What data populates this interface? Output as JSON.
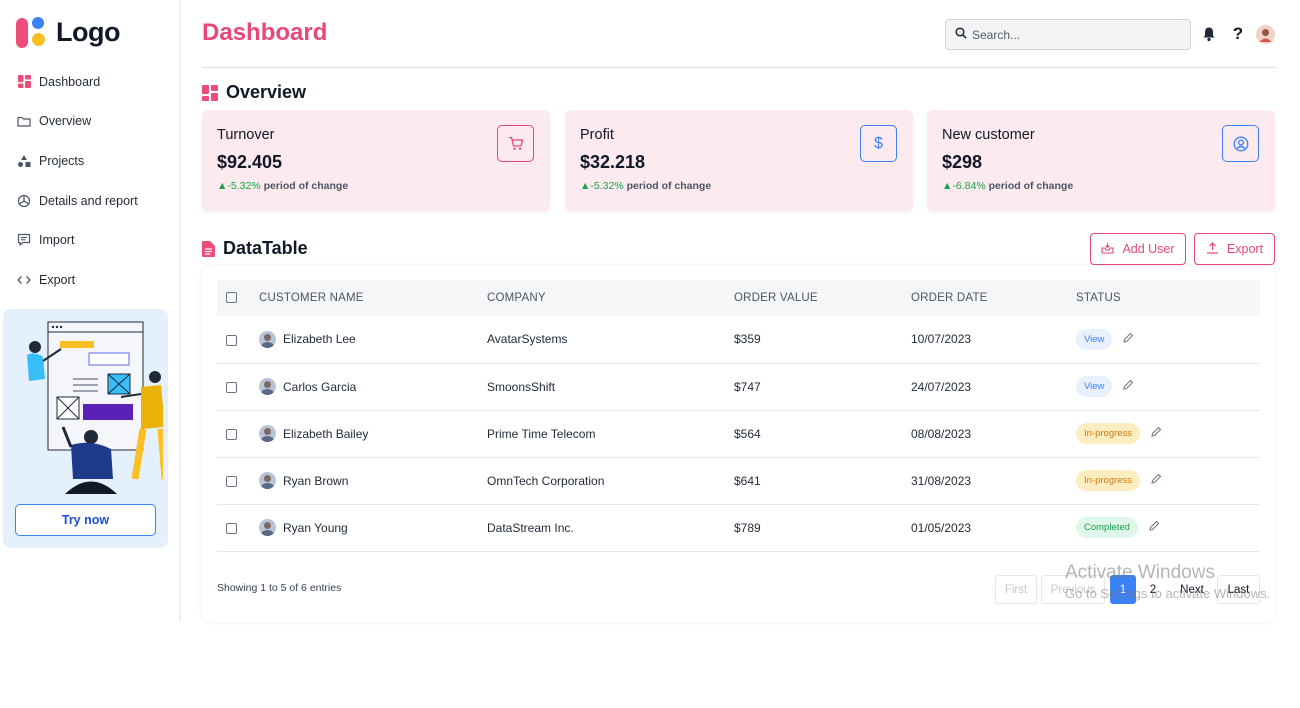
{
  "logo": {
    "text": "Logo"
  },
  "sidebar": {
    "items": [
      {
        "label": "Dashboard",
        "icon": "dashboard-grid-icon",
        "active": true
      },
      {
        "label": "Overview",
        "icon": "folder-icon"
      },
      {
        "label": "Projects",
        "icon": "shapes-icon"
      },
      {
        "label": "Details and report",
        "icon": "pie-chart-icon"
      },
      {
        "label": "Import",
        "icon": "message-icon"
      },
      {
        "label": "Export",
        "icon": "code-icon"
      }
    ],
    "promo": {
      "button_label": "Try now"
    }
  },
  "header": {
    "title": "Dashboard",
    "search_placeholder": "Search...",
    "help_label": "?"
  },
  "overview": {
    "title": "Overview",
    "cards": [
      {
        "label": "Turnover",
        "value": "$92.405",
        "change_pct": "▲-5.32%",
        "change_text": "period of change",
        "icon": "cart-icon",
        "accent": "#e8467c"
      },
      {
        "label": "Profit",
        "value": "$32.218",
        "change_pct": "▲-5.32%",
        "change_text": "period of change",
        "icon": "dollar-icon",
        "accent": "#3b82f6"
      },
      {
        "label": "New customer",
        "value": "$298",
        "change_pct": "▲-6.84%",
        "change_text": "period of change",
        "icon": "user-circle-icon",
        "accent": "#3b82f6"
      }
    ]
  },
  "datatable": {
    "title": "DataTable",
    "add_user_label": "Add User",
    "export_label": "Export",
    "columns": [
      "CUSTOMER NAME",
      "COMPANY",
      "ORDER VALUE",
      "ORDER DATE",
      "STATUS"
    ],
    "rows": [
      {
        "name": "Elizabeth Lee",
        "company": "AvatarSystems",
        "value": "$359",
        "date": "10/07/2023",
        "status": "View",
        "status_type": "view"
      },
      {
        "name": "Carlos Garcia",
        "company": "SmoonsShift",
        "value": "$747",
        "date": "24/07/2023",
        "status": "View",
        "status_type": "view"
      },
      {
        "name": "Elizabeth Bailey",
        "company": "Prime Time Telecom",
        "value": "$564",
        "date": "08/08/2023",
        "status": "In-progress",
        "status_type": "progress"
      },
      {
        "name": "Ryan Brown",
        "company": "OmnTech Corporation",
        "value": "$641",
        "date": "31/08/2023",
        "status": "In-progress",
        "status_type": "progress"
      },
      {
        "name": "Ryan Young",
        "company": "DataStream Inc.",
        "value": "$789",
        "date": "01/05/2023",
        "status": "Completed",
        "status_type": "done"
      }
    ],
    "showing": "Showing 1 to 5 of 6 entries",
    "pagination": {
      "first": "First",
      "previous": "Previous",
      "page1": "1",
      "page2": "2",
      "next": "Next",
      "last": "Last"
    }
  },
  "watermark": {
    "line1": "Activate Windows",
    "line2": "Go to Settings to activate Windows."
  },
  "colors": {
    "brand_pink": "#e8467c",
    "accent_blue": "#3b82f6",
    "card_bg": "#fdeaee",
    "success": "#16a34a"
  }
}
